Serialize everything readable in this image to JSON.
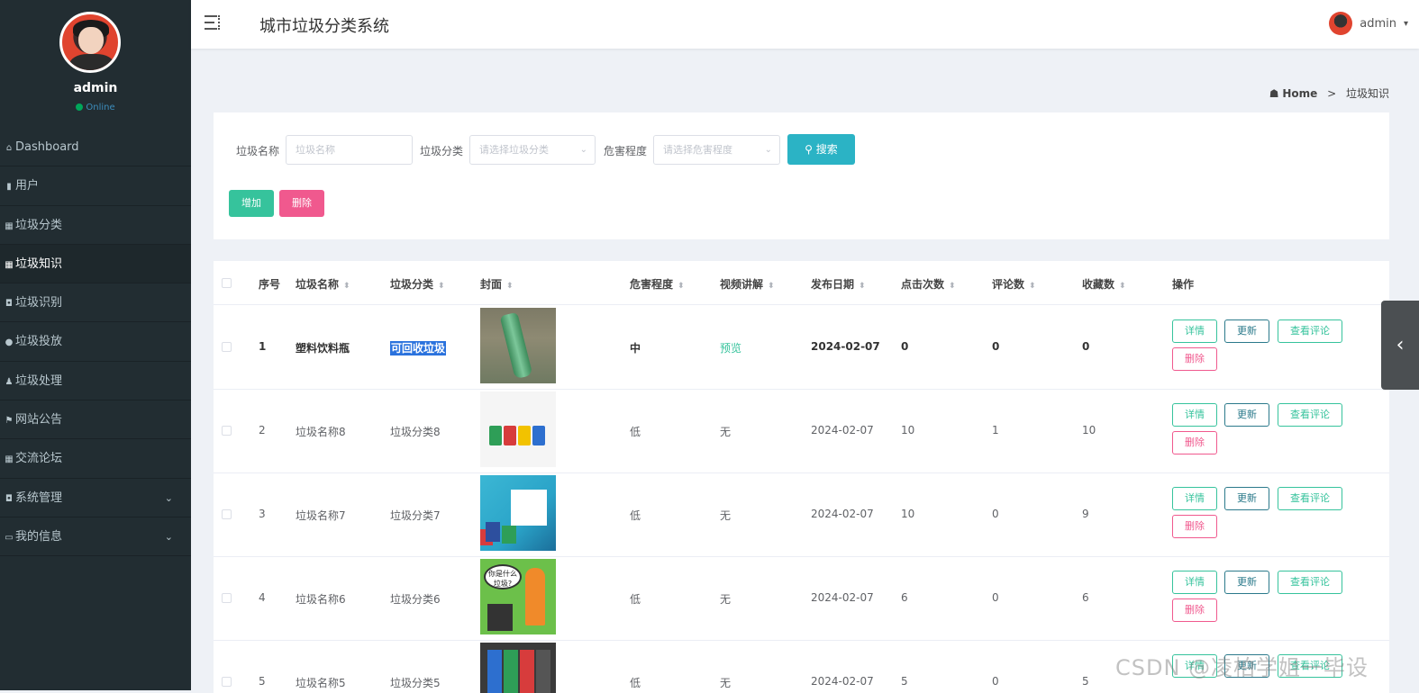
{
  "sidebar": {
    "username": "admin",
    "status": "Online",
    "items": [
      {
        "label": "Dashboard",
        "icon": "home-icon"
      },
      {
        "label": "用户",
        "icon": "bar-chart-icon"
      },
      {
        "label": "垃圾分类",
        "icon": "grid-icon"
      },
      {
        "label": "垃圾知识",
        "icon": "grid-icon",
        "active": true
      },
      {
        "label": "垃圾识别",
        "icon": "camera-icon"
      },
      {
        "label": "垃圾投放",
        "icon": "pin-icon"
      },
      {
        "label": "垃圾处理",
        "icon": "user-icon"
      },
      {
        "label": "网站公告",
        "icon": "flag-icon"
      },
      {
        "label": "交流论坛",
        "icon": "grid-icon"
      },
      {
        "label": "系统管理",
        "icon": "camera-icon",
        "expandable": true
      },
      {
        "label": "我的信息",
        "icon": "card-icon",
        "expandable": true
      }
    ]
  },
  "header": {
    "title": "城市垃圾分类系统",
    "user": "admin"
  },
  "breadcrumb": {
    "home": "Home",
    "sep": ">",
    "current": "垃圾知识"
  },
  "search": {
    "name_label": "垃圾名称",
    "name_placeholder": "垃圾名称",
    "category_label": "垃圾分类",
    "category_placeholder": "请选择垃圾分类",
    "hazard_label": "危害程度",
    "hazard_placeholder": "请选择危害程度",
    "search_button": "搜索",
    "add_button": "增加",
    "delete_button": "删除"
  },
  "table": {
    "columns": [
      "序号",
      "垃圾名称",
      "垃圾分类",
      "封面",
      "危害程度",
      "视频讲解",
      "发布日期",
      "点击次数",
      "评论数",
      "收藏数",
      "操作"
    ],
    "rows": [
      {
        "index": "1",
        "name": "塑料饮料瓶",
        "category": "可回收垃圾",
        "hazard": "中",
        "video": "预览",
        "date": "2024-02-07",
        "clicks": "0",
        "comments": "0",
        "favorites": "0"
      },
      {
        "index": "2",
        "name": "垃圾名称8",
        "category": "垃圾分类8",
        "hazard": "低",
        "video": "无",
        "date": "2024-02-07",
        "clicks": "10",
        "comments": "1",
        "favorites": "10"
      },
      {
        "index": "3",
        "name": "垃圾名称7",
        "category": "垃圾分类7",
        "hazard": "低",
        "video": "无",
        "date": "2024-02-07",
        "clicks": "10",
        "comments": "0",
        "favorites": "9"
      },
      {
        "index": "4",
        "name": "垃圾名称6",
        "category": "垃圾分类6",
        "hazard": "低",
        "video": "无",
        "date": "2024-02-07",
        "clicks": "6",
        "comments": "0",
        "favorites": "6"
      },
      {
        "index": "5",
        "name": "垃圾名称5",
        "category": "垃圾分类5",
        "hazard": "低",
        "video": "无",
        "date": "2024-02-07",
        "clicks": "5",
        "comments": "0",
        "favorites": "5"
      }
    ],
    "actions": {
      "detail": "详情",
      "update": "更新",
      "comments": "查看评论",
      "delete": "删除"
    }
  },
  "thumbnail_texts": {
    "row4_bubble": "你是什么垃圾?"
  },
  "watermark": "CSDN @凌柏学姐一毕设",
  "colors": {
    "sidebar_bg": "#222d32",
    "primary": "#2bb3c5",
    "success": "#36c39c",
    "danger": "#f0598e",
    "highlight": "#2a72dd"
  }
}
